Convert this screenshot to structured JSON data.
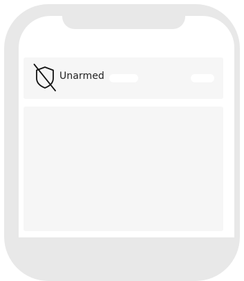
{
  "status": {
    "label": "Unarmed",
    "icon": "shield-off-icon"
  },
  "colors": {
    "frame": "#e8e8e8",
    "panel": "#f6f6f6",
    "text": "#222222"
  }
}
